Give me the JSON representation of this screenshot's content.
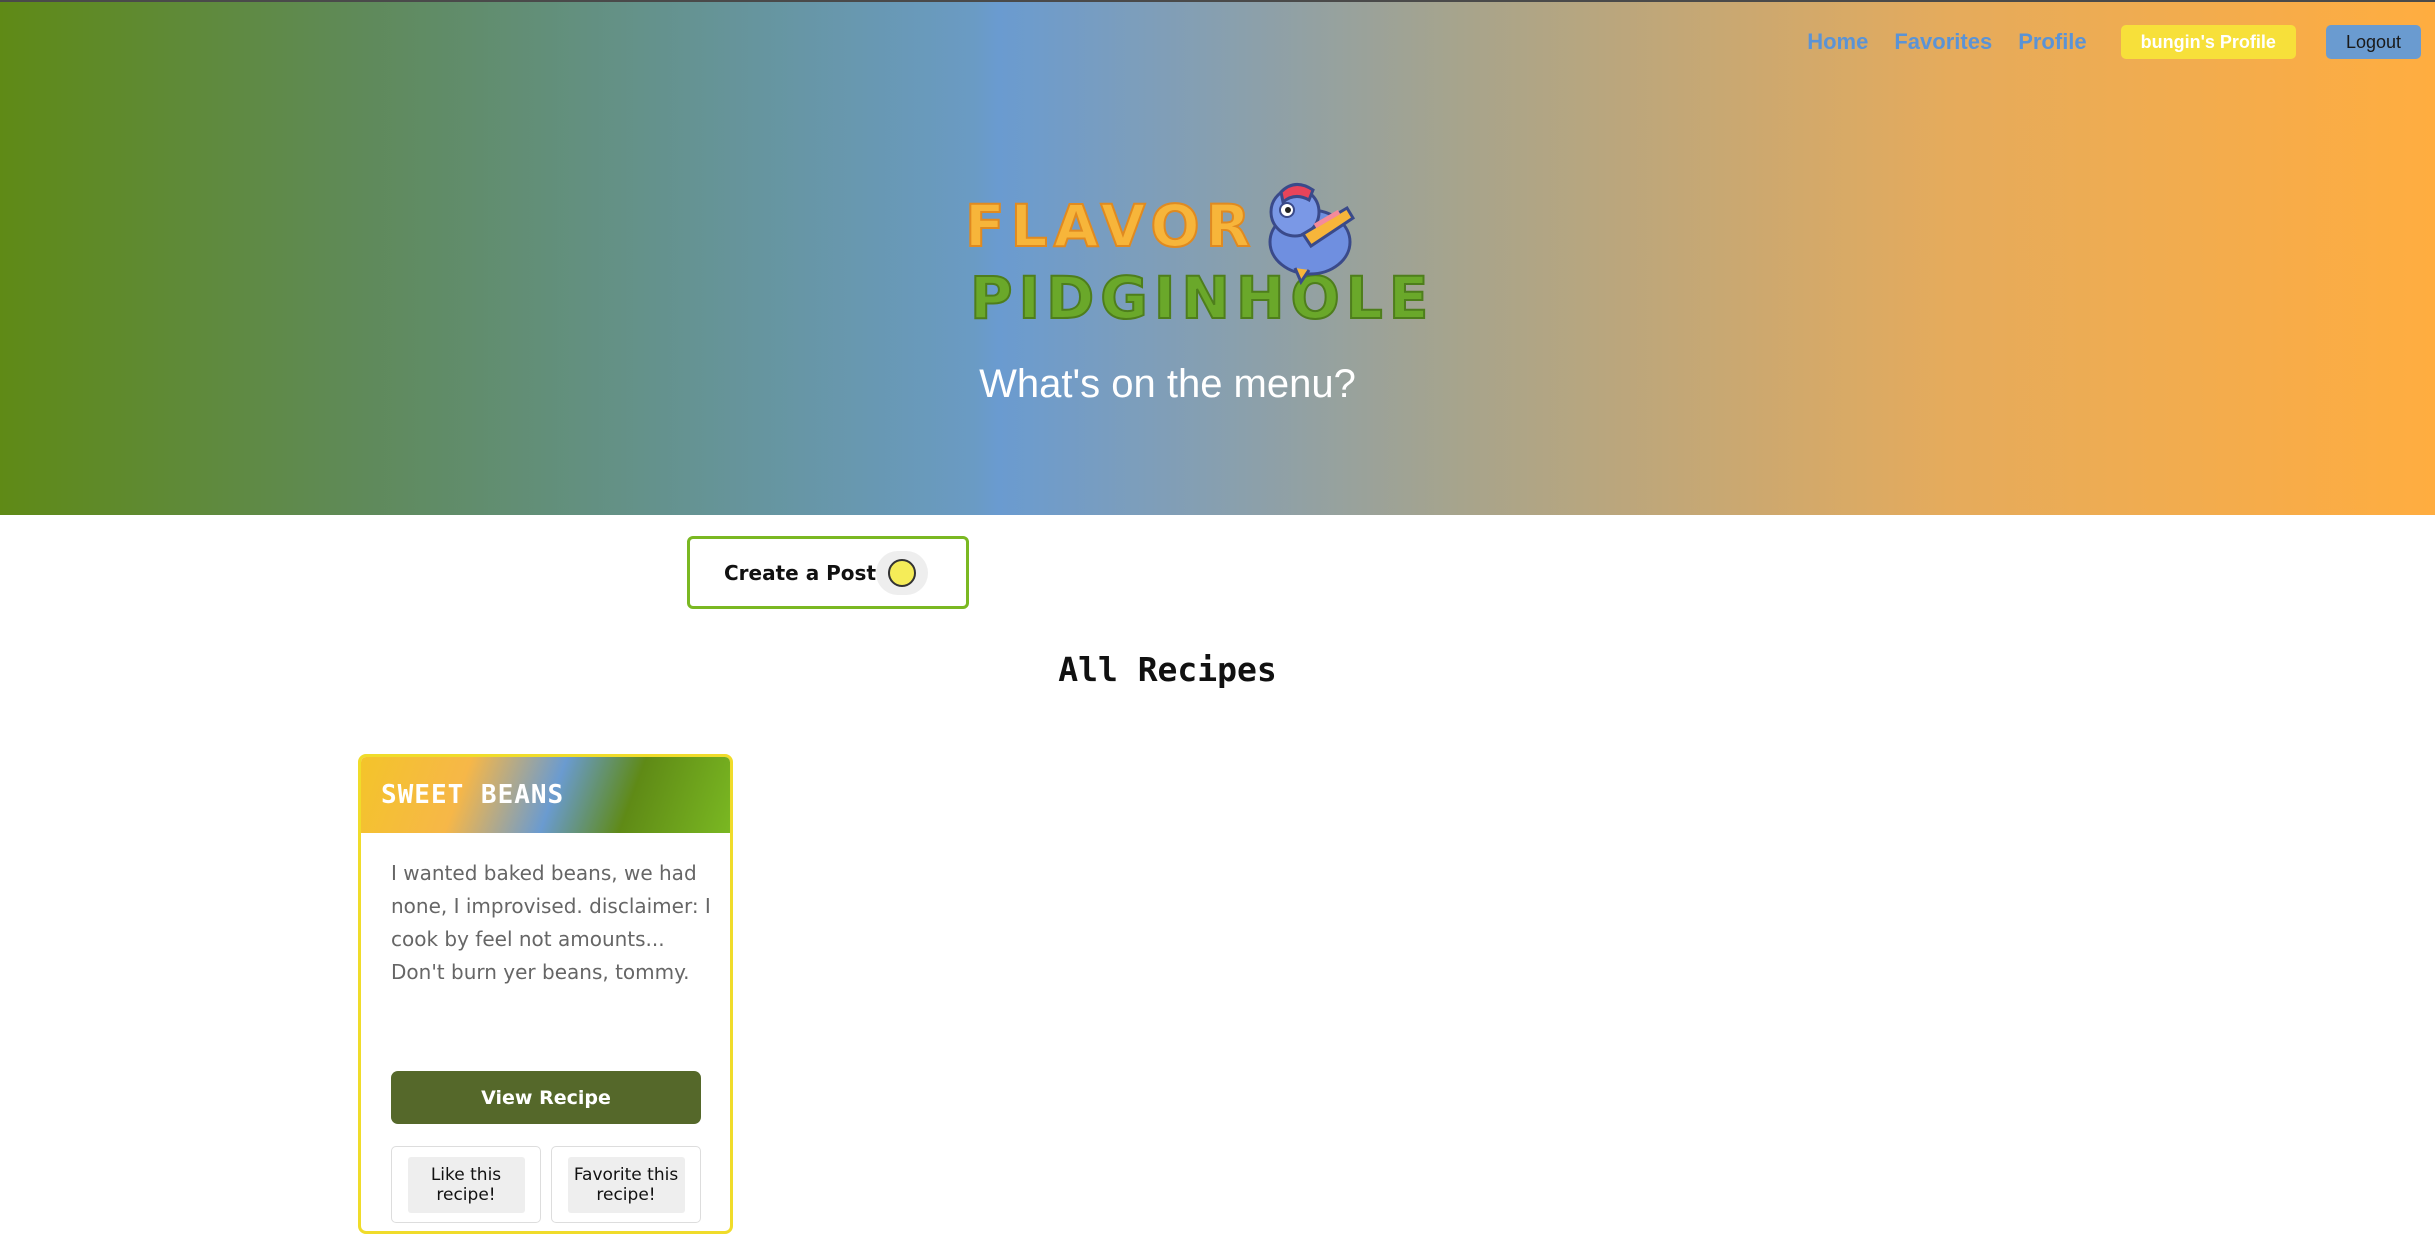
{
  "nav": {
    "home": "Home",
    "favorites": "Favorites",
    "profile": "Profile",
    "user_profile": "bungin's Profile",
    "logout": "Logout"
  },
  "hero": {
    "logo_line1": "FLAVOR",
    "logo_line2": "PIDGINHOLE",
    "tagline": "What's on the menu?"
  },
  "create_post": {
    "label": "Create a Post"
  },
  "section_title": "All Recipes",
  "recipes": [
    {
      "title": "SWEET BEANS",
      "description": "I wanted baked beans, we had none, I improvised. disclaimer: I cook by feel not amounts... Don't burn yer beans, tommy.",
      "view_label": "View Recipe",
      "like_label": "Like this recipe!",
      "favorite_label": "Favorite this recipe!"
    }
  ],
  "colors": {
    "nav_link": "#5b93d5",
    "profile_button": "#f7e03a",
    "logout_button": "#6a9bd0",
    "view_button": "#55682a",
    "create_border": "#7ab822",
    "card_border": "#f0dc2a"
  }
}
